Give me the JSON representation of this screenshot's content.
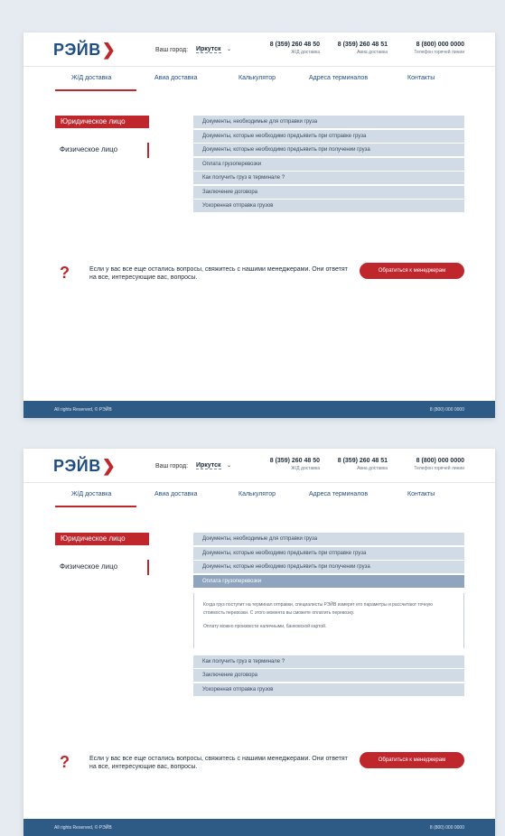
{
  "header": {
    "logo": "РЭЙВ",
    "logo_arrow": "❯",
    "city_label": "Ваш город:",
    "city_value": "Иркутск",
    "city_caret": "⌄",
    "phones": [
      {
        "number": "8 (359) 260 48 50",
        "caption": "Ж/Д доставка"
      },
      {
        "number": "8 (359) 260 48 51",
        "caption": "Авиа доставка"
      },
      {
        "number": "8 (800) 000 0000",
        "caption": "Телефон горячей линии"
      }
    ]
  },
  "nav": {
    "items": [
      "Ж/Д доставка",
      "Авиа доставка",
      "Калькулятор",
      "Адреса терминалов",
      "Контакты"
    ],
    "active_index": 0
  },
  "sidebar": {
    "legal": "Юридическое лицо",
    "person": "Физическое лицо"
  },
  "accordion": {
    "items": [
      "Документы, необходимые для отправки груза",
      "Документы, которые необходимо предъявить при отправке груза",
      "Документы, которые необходимо предъявить при получении груза",
      "Оплата грузоперевозки",
      "Как получить груз в терминале ?",
      "Заключение договора",
      "Ускоренная отправка грузов"
    ],
    "expanded_index": 3,
    "panel_text_1": "Когда груз поступит на терминал отправки, специалисты РЭЙВ измерят его параметры и рассчитают точную стоимость перевозки. С этого момента вы сможете оплатить перевозку.",
    "panel_text_2": "Оплату можно произвести наличными, банковской картой."
  },
  "help": {
    "icon": "?",
    "text": "Если у вас все еще остались вопросы, свяжитесь с нашими менеджерами. Они ответят на все, интересующие вас, вопросы.",
    "button": "Обратиться к менеджерам"
  },
  "footer": {
    "copyright": "All rights Reserved, © РЭЙВ",
    "phone": "8 (800) 000 0000"
  },
  "colors": {
    "brand_blue": "#1f4e82",
    "accent_red": "#c0272d",
    "footer_bg": "#2e5b86",
    "accordion_bg": "#d0dbe6",
    "accordion_active": "#8fa5bf"
  }
}
